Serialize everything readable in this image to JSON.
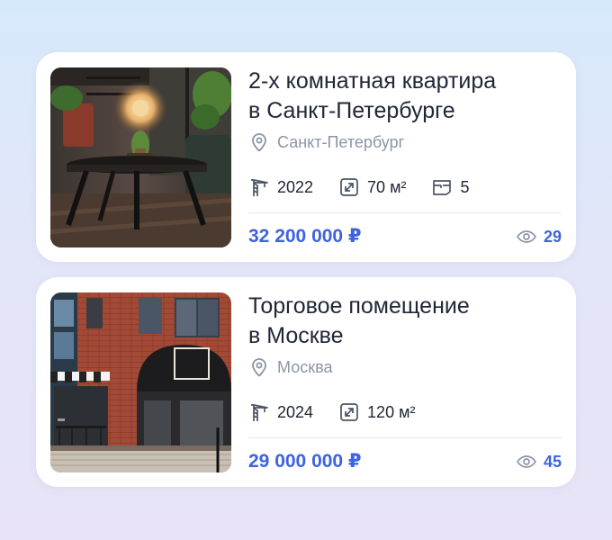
{
  "listings": [
    {
      "title_line1": "2-х комнатная квартира",
      "title_line2": "в Санкт-Петербурге",
      "location": "Санкт-Петербург",
      "year": "2022",
      "area": "70 м²",
      "rooms": "5",
      "price": "32 200 000 ₽",
      "views": "29",
      "photo": "living-room-interior"
    },
    {
      "title_line1": "Торговое помещение",
      "title_line2": "в Москве",
      "location": "Москва",
      "year": "2024",
      "area": "120 м²",
      "price": "29 000 000 ₽",
      "views": "45",
      "photo": "brick-storefront"
    }
  ],
  "icons": {
    "location": "location-pin-icon",
    "year": "crane-icon",
    "area": "resize-icon",
    "rooms": "rooms-icon",
    "views": "eye-icon"
  },
  "colors": {
    "accent": "#3d63e0",
    "text": "#222738",
    "muted": "#8c94a6"
  }
}
